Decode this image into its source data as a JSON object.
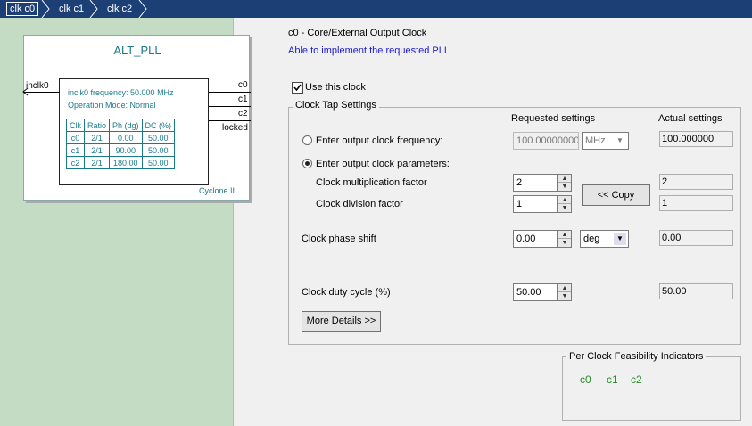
{
  "tabs": [
    "clk c0",
    "clk c1",
    "clk c2"
  ],
  "pll": {
    "title": "ALT_PLL",
    "input_port": "inclk0",
    "freq_text": "inclk0 frequency: 50.000 MHz",
    "mode_text": "Operation Mode: Normal",
    "table_headers": [
      "Clk",
      "Ratio",
      "Ph (dg)",
      "DC (%)"
    ],
    "table_rows": [
      [
        "c0",
        "2/1",
        "0.00",
        "50.00"
      ],
      [
        "c1",
        "2/1",
        "90.00",
        "50.00"
      ],
      [
        "c2",
        "2/1",
        "180.00",
        "50.00"
      ]
    ],
    "outputs": [
      "c0",
      "c1",
      "c2",
      "locked"
    ],
    "device": "Cyclone II"
  },
  "header": {
    "title": "c0 - Core/External Output Clock",
    "status": "Able to implement the requested PLL"
  },
  "use_clock": {
    "label": "Use this clock",
    "checked": true
  },
  "tap": {
    "legend": "Clock Tap Settings",
    "requested_header": "Requested settings",
    "actual_header": "Actual settings",
    "freq_radio": "Enter output clock frequency:",
    "freq_value": "100.00000000",
    "freq_unit": "MHz",
    "freq_actual": "100.000000",
    "param_radio": "Enter output clock parameters:",
    "mult_label": "Clock multiplication factor",
    "mult_value": "2",
    "mult_actual": "2",
    "div_label": "Clock division factor",
    "div_value": "1",
    "div_actual": "1",
    "copy_button": "<< Copy",
    "phase_label": "Clock phase shift",
    "phase_value": "0.00",
    "phase_unit": "deg",
    "phase_actual": "0.00",
    "duty_label": "Clock duty cycle (%)",
    "duty_value": "50.00",
    "duty_actual": "50.00",
    "more_button": "More Details >>"
  },
  "feasibility": {
    "legend": "Per Clock Feasibility Indicators",
    "clocks": [
      "c0",
      "c1",
      "c2"
    ]
  }
}
